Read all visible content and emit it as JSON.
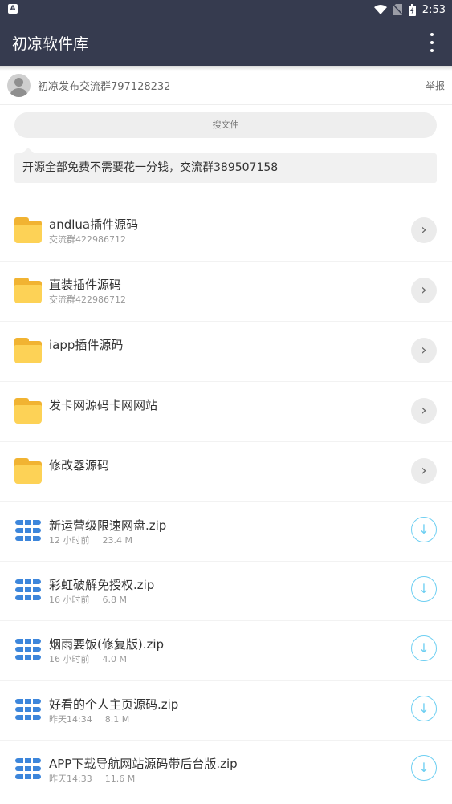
{
  "statusbar": {
    "time": "2:53",
    "left_icon": "A"
  },
  "app": {
    "title": "初凉软件库"
  },
  "profile": {
    "name": "初凉发布交流群797128232",
    "report": "举报"
  },
  "search": {
    "placeholder": "搜文件"
  },
  "notice": {
    "text": "开源全部免费不需要花一分钱，交流群389507158"
  },
  "folders": [
    {
      "name": "andlua插件源码",
      "sub": "交流群422986712"
    },
    {
      "name": "直装插件源码",
      "sub": "交流群422986712"
    },
    {
      "name": "iapp插件源码",
      "sub": ""
    },
    {
      "name": "发卡网源码卡网网站",
      "sub": ""
    },
    {
      "name": "修改器源码",
      "sub": ""
    }
  ],
  "files": [
    {
      "name": "新运营级限速网盘.zip",
      "time": "12 小时前",
      "size": "23.4 M"
    },
    {
      "name": "彩虹破解免授权.zip",
      "time": "16 小时前",
      "size": "6.8 M"
    },
    {
      "name": "烟雨要饭(修复版).zip",
      "time": "16 小时前",
      "size": "4.0 M"
    },
    {
      "name": "好看的个人主页源码.zip",
      "time": "昨天14:34",
      "size": "8.1 M"
    },
    {
      "name": "APP下载导航网站源码带后台版.zip",
      "time": "昨天14:33",
      "size": "11.6 M"
    }
  ],
  "icons": {
    "folder": "folder-icon",
    "zip": "zip-file-icon",
    "open": "chevron-right-icon",
    "download": "download-icon",
    "menu": "more-vert-icon"
  },
  "colors": {
    "toolbar": "#363b4f",
    "folder": "#fdd256",
    "zip": "#3d86db",
    "download": "#6ecff2"
  }
}
